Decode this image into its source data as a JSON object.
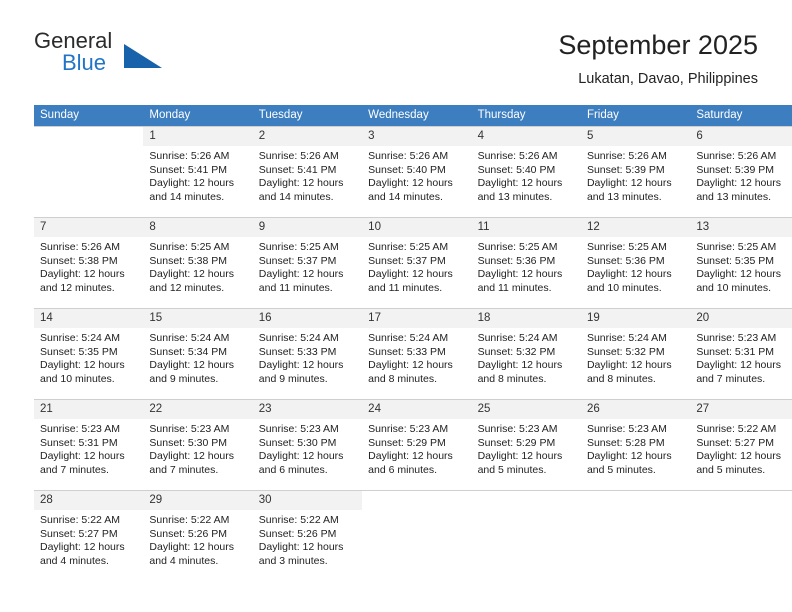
{
  "brand": {
    "name_part1": "General",
    "name_part2": "Blue",
    "logo_icon": "triangle-logo-icon",
    "accent_color": "#1862ab",
    "blue_text_color": "#2175c6"
  },
  "header": {
    "month_title": "September 2025",
    "location": "Lukatan, Davao, Philippines",
    "header_bg_color": "#3c7ebf",
    "daynum_bg_color": "#f2f2f2"
  },
  "weekday_headers": [
    "Sunday",
    "Monday",
    "Tuesday",
    "Wednesday",
    "Thursday",
    "Friday",
    "Saturday"
  ],
  "weeks": [
    [
      {
        "day": "",
        "sunrise": "",
        "sunset": "",
        "daylight": "",
        "empty": true
      },
      {
        "day": "1",
        "sunrise": "Sunrise: 5:26 AM",
        "sunset": "Sunset: 5:41 PM",
        "daylight": "Daylight: 12 hours and 14 minutes.",
        "empty": false
      },
      {
        "day": "2",
        "sunrise": "Sunrise: 5:26 AM",
        "sunset": "Sunset: 5:41 PM",
        "daylight": "Daylight: 12 hours and 14 minutes.",
        "empty": false
      },
      {
        "day": "3",
        "sunrise": "Sunrise: 5:26 AM",
        "sunset": "Sunset: 5:40 PM",
        "daylight": "Daylight: 12 hours and 14 minutes.",
        "empty": false
      },
      {
        "day": "4",
        "sunrise": "Sunrise: 5:26 AM",
        "sunset": "Sunset: 5:40 PM",
        "daylight": "Daylight: 12 hours and 13 minutes.",
        "empty": false
      },
      {
        "day": "5",
        "sunrise": "Sunrise: 5:26 AM",
        "sunset": "Sunset: 5:39 PM",
        "daylight": "Daylight: 12 hours and 13 minutes.",
        "empty": false
      },
      {
        "day": "6",
        "sunrise": "Sunrise: 5:26 AM",
        "sunset": "Sunset: 5:39 PM",
        "daylight": "Daylight: 12 hours and 13 minutes.",
        "empty": false
      }
    ],
    [
      {
        "day": "7",
        "sunrise": "Sunrise: 5:26 AM",
        "sunset": "Sunset: 5:38 PM",
        "daylight": "Daylight: 12 hours and 12 minutes.",
        "empty": false
      },
      {
        "day": "8",
        "sunrise": "Sunrise: 5:25 AM",
        "sunset": "Sunset: 5:38 PM",
        "daylight": "Daylight: 12 hours and 12 minutes.",
        "empty": false
      },
      {
        "day": "9",
        "sunrise": "Sunrise: 5:25 AM",
        "sunset": "Sunset: 5:37 PM",
        "daylight": "Daylight: 12 hours and 11 minutes.",
        "empty": false
      },
      {
        "day": "10",
        "sunrise": "Sunrise: 5:25 AM",
        "sunset": "Sunset: 5:37 PM",
        "daylight": "Daylight: 12 hours and 11 minutes.",
        "empty": false
      },
      {
        "day": "11",
        "sunrise": "Sunrise: 5:25 AM",
        "sunset": "Sunset: 5:36 PM",
        "daylight": "Daylight: 12 hours and 11 minutes.",
        "empty": false
      },
      {
        "day": "12",
        "sunrise": "Sunrise: 5:25 AM",
        "sunset": "Sunset: 5:36 PM",
        "daylight": "Daylight: 12 hours and 10 minutes.",
        "empty": false
      },
      {
        "day": "13",
        "sunrise": "Sunrise: 5:25 AM",
        "sunset": "Sunset: 5:35 PM",
        "daylight": "Daylight: 12 hours and 10 minutes.",
        "empty": false
      }
    ],
    [
      {
        "day": "14",
        "sunrise": "Sunrise: 5:24 AM",
        "sunset": "Sunset: 5:35 PM",
        "daylight": "Daylight: 12 hours and 10 minutes.",
        "empty": false
      },
      {
        "day": "15",
        "sunrise": "Sunrise: 5:24 AM",
        "sunset": "Sunset: 5:34 PM",
        "daylight": "Daylight: 12 hours and 9 minutes.",
        "empty": false
      },
      {
        "day": "16",
        "sunrise": "Sunrise: 5:24 AM",
        "sunset": "Sunset: 5:33 PM",
        "daylight": "Daylight: 12 hours and 9 minutes.",
        "empty": false
      },
      {
        "day": "17",
        "sunrise": "Sunrise: 5:24 AM",
        "sunset": "Sunset: 5:33 PM",
        "daylight": "Daylight: 12 hours and 8 minutes.",
        "empty": false
      },
      {
        "day": "18",
        "sunrise": "Sunrise: 5:24 AM",
        "sunset": "Sunset: 5:32 PM",
        "daylight": "Daylight: 12 hours and 8 minutes.",
        "empty": false
      },
      {
        "day": "19",
        "sunrise": "Sunrise: 5:24 AM",
        "sunset": "Sunset: 5:32 PM",
        "daylight": "Daylight: 12 hours and 8 minutes.",
        "empty": false
      },
      {
        "day": "20",
        "sunrise": "Sunrise: 5:23 AM",
        "sunset": "Sunset: 5:31 PM",
        "daylight": "Daylight: 12 hours and 7 minutes.",
        "empty": false
      }
    ],
    [
      {
        "day": "21",
        "sunrise": "Sunrise: 5:23 AM",
        "sunset": "Sunset: 5:31 PM",
        "daylight": "Daylight: 12 hours and 7 minutes.",
        "empty": false
      },
      {
        "day": "22",
        "sunrise": "Sunrise: 5:23 AM",
        "sunset": "Sunset: 5:30 PM",
        "daylight": "Daylight: 12 hours and 7 minutes.",
        "empty": false
      },
      {
        "day": "23",
        "sunrise": "Sunrise: 5:23 AM",
        "sunset": "Sunset: 5:30 PM",
        "daylight": "Daylight: 12 hours and 6 minutes.",
        "empty": false
      },
      {
        "day": "24",
        "sunrise": "Sunrise: 5:23 AM",
        "sunset": "Sunset: 5:29 PM",
        "daylight": "Daylight: 12 hours and 6 minutes.",
        "empty": false
      },
      {
        "day": "25",
        "sunrise": "Sunrise: 5:23 AM",
        "sunset": "Sunset: 5:29 PM",
        "daylight": "Daylight: 12 hours and 5 minutes.",
        "empty": false
      },
      {
        "day": "26",
        "sunrise": "Sunrise: 5:23 AM",
        "sunset": "Sunset: 5:28 PM",
        "daylight": "Daylight: 12 hours and 5 minutes.",
        "empty": false
      },
      {
        "day": "27",
        "sunrise": "Sunrise: 5:22 AM",
        "sunset": "Sunset: 5:27 PM",
        "daylight": "Daylight: 12 hours and 5 minutes.",
        "empty": false
      }
    ],
    [
      {
        "day": "28",
        "sunrise": "Sunrise: 5:22 AM",
        "sunset": "Sunset: 5:27 PM",
        "daylight": "Daylight: 12 hours and 4 minutes.",
        "empty": false
      },
      {
        "day": "29",
        "sunrise": "Sunrise: 5:22 AM",
        "sunset": "Sunset: 5:26 PM",
        "daylight": "Daylight: 12 hours and 4 minutes.",
        "empty": false
      },
      {
        "day": "30",
        "sunrise": "Sunrise: 5:22 AM",
        "sunset": "Sunset: 5:26 PM",
        "daylight": "Daylight: 12 hours and 3 minutes.",
        "empty": false
      },
      {
        "day": "",
        "sunrise": "",
        "sunset": "",
        "daylight": "",
        "empty": true
      },
      {
        "day": "",
        "sunrise": "",
        "sunset": "",
        "daylight": "",
        "empty": true
      },
      {
        "day": "",
        "sunrise": "",
        "sunset": "",
        "daylight": "",
        "empty": true
      },
      {
        "day": "",
        "sunrise": "",
        "sunset": "",
        "daylight": "",
        "empty": true
      }
    ]
  ]
}
